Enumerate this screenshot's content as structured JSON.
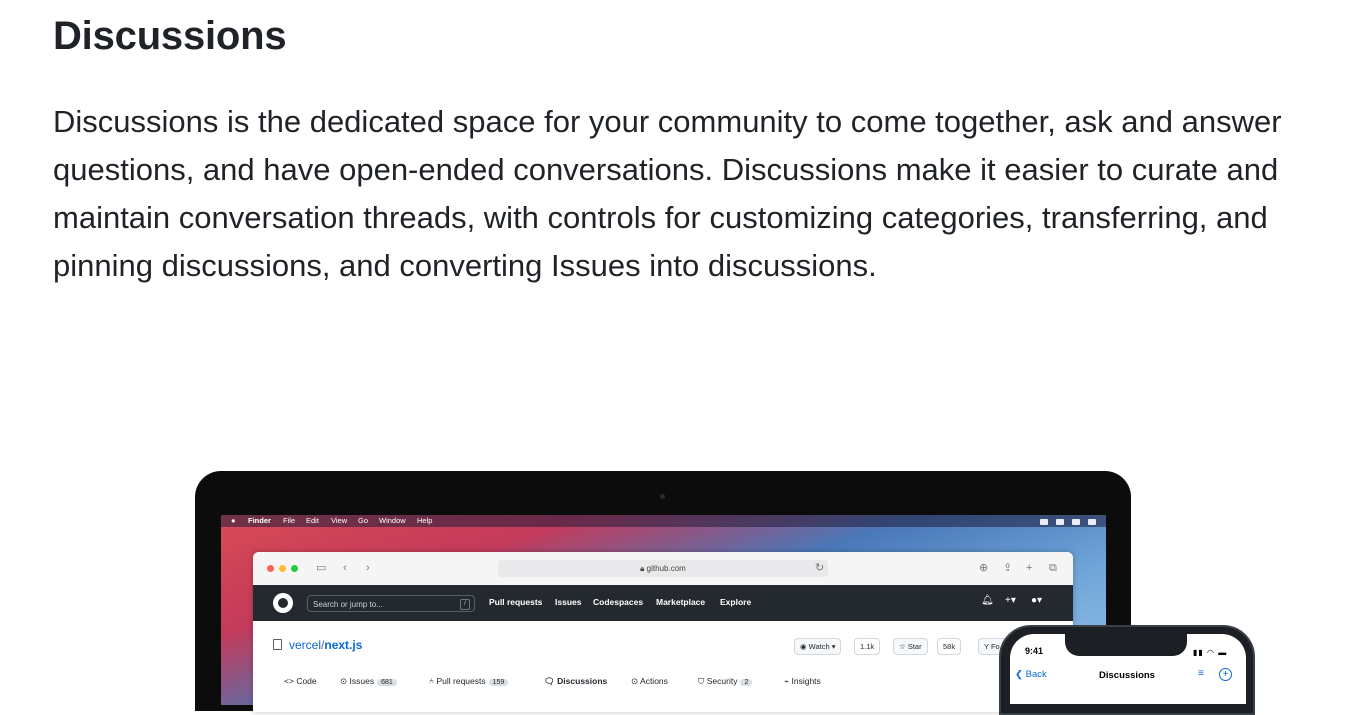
{
  "section": {
    "title": "Discussions",
    "body": "Discussions is the dedicated space for your community to come together, ask and answer questions, and have open-ended conversations. Discussions make it easier to curate and maintain conversation threads, with controls for customizing categories, transferring, and pinning discussions, and converting Issues into discussions."
  },
  "mac_menu": {
    "apple_icon": "apple-icon",
    "items": [
      "Finder",
      "File",
      "Edit",
      "View",
      "Go",
      "Window",
      "Help"
    ]
  },
  "browser": {
    "url": "github.com",
    "traffic_light_colors": [
      "#ff5f57",
      "#febc2e",
      "#28c840"
    ]
  },
  "github": {
    "search_placeholder": "Search or jump to...",
    "search_shortcut": "/",
    "nav": [
      "Pull requests",
      "Issues",
      "Codespaces",
      "Marketplace",
      "Explore"
    ],
    "repo_owner": "vercel",
    "repo_sep": "/",
    "repo_name": "next.js",
    "watch_label": "Watch",
    "watch_count": "1.1k",
    "star_label": "Star",
    "star_count": "58k",
    "fork_label": "Fo",
    "tabs": [
      {
        "label": "Code",
        "count": ""
      },
      {
        "label": "Issues",
        "count": "681"
      },
      {
        "label": "Pull requests",
        "count": "159"
      },
      {
        "label": "Discussions",
        "count": ""
      },
      {
        "label": "Actions",
        "count": ""
      },
      {
        "label": "Security",
        "count": "2"
      },
      {
        "label": "Insights",
        "count": ""
      }
    ],
    "active_tab": "Discussions"
  },
  "phone": {
    "time": "9:41",
    "back_label": "Back",
    "title": "Discussions"
  }
}
